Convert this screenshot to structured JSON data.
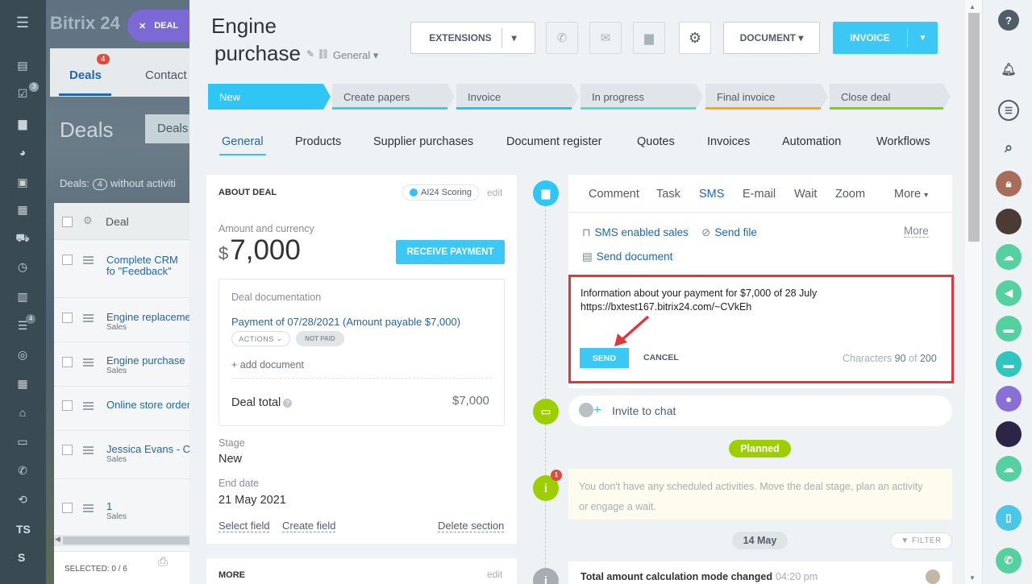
{
  "background": {
    "logo": "Bitrix 24",
    "deal_chip": "DEAL",
    "tabs": [
      {
        "label": "Deals",
        "count": "4"
      },
      {
        "label": "Contact"
      }
    ],
    "title": "Deals",
    "deals_button": "Deals",
    "filter_text": "Deals:",
    "filter_count": "4",
    "filter_suffix": "without activiti",
    "grid_header": "Deal",
    "rows": [
      {
        "title": "Complete CRM fo \"Feedback\"",
        "sub": ""
      },
      {
        "title": "Engine replaceme",
        "sub": "Sales"
      },
      {
        "title": "Engine purchase",
        "sub": "Sales"
      },
      {
        "title": "Online store order",
        "sub": ""
      },
      {
        "title": "Jessica Evans - C",
        "sub": "Sales"
      },
      {
        "title": "1",
        "sub": "Sales"
      }
    ],
    "footer": "SELECTED: 0 / 6",
    "left_icons": [
      "feed-icon",
      "tasks-icon",
      "chat-icon",
      "groups-icon",
      "contacts-icon",
      "calendar-icon",
      "shop-icon",
      "time-icon",
      "documents-icon",
      "crm-icon",
      "target-icon",
      "apps-icon",
      "store-icon",
      "calendar2-icon",
      "phone-icon",
      "sync-icon"
    ],
    "left_badges": {
      "tasks": "3",
      "crm": "4"
    },
    "left_text": [
      "TS",
      "S"
    ]
  },
  "header": {
    "title_line1": "Engine",
    "title_line2": "purchase",
    "category": "General",
    "buttons": {
      "extensions": "EXTENSIONS",
      "document": "DOCUMENT",
      "invoice": "INVOICE"
    }
  },
  "stages": [
    {
      "label": "New",
      "color": "#2fc6f6"
    },
    {
      "label": "Create papers",
      "color": "#3bc8f5"
    },
    {
      "label": "Invoice",
      "color": "#1ec6fa"
    },
    {
      "label": "In progress",
      "color": "#47e4c2"
    },
    {
      "label": "Final invoice",
      "color": "#ffa900"
    },
    {
      "label": "Close deal",
      "color": "#7bd500"
    }
  ],
  "tabs": [
    "General",
    "Products",
    "Supplier purchases",
    "Document register",
    "Quotes",
    "Invoices",
    "Automation",
    "Workflows"
  ],
  "about": {
    "heading": "ABOUT DEAL",
    "ai_scoring": "AI24 Scoring",
    "edit": "edit",
    "amount_label": "Amount and currency",
    "currency": "$",
    "amount": "7,000",
    "receive_payment": "RECEIVE PAYMENT",
    "doc_label": "Deal documentation",
    "doc_link": "Payment of 07/28/2021 (Amount payable $7,000)",
    "actions": "ACTIONS",
    "not_paid": "NOT PAID",
    "add_document": "+ add document",
    "deal_total_label": "Deal total",
    "deal_total_value": "$7,000",
    "stage_label": "Stage",
    "stage_value": "New",
    "end_date_label": "End date",
    "end_date_value": "21 May 2021",
    "select_field": "Select field",
    "create_field": "Create field",
    "delete_section": "Delete section",
    "more_heading": "MORE",
    "more_edit": "edit"
  },
  "editor": {
    "tabs": [
      "Comment",
      "Task",
      "SMS",
      "E-mail",
      "Wait",
      "Zoom",
      "More"
    ],
    "active_tab": "SMS",
    "sms_enabled_sales": "SMS enabled sales",
    "send_file": "Send file",
    "more": "More",
    "send_document": "Send document",
    "message": "Information about your payment for $7,000 of 28 July\nhttps://bxtest167.bitrix24.com/~CVkEh",
    "send": "SEND",
    "cancel": "CANCEL",
    "chars_label": "Characters",
    "chars_count": "90",
    "chars_of": "of",
    "chars_max": "200"
  },
  "timeline": {
    "invite": "Invite to chat",
    "planned": "Planned",
    "badge": "1",
    "empty_text": "You don't have any scheduled activities. Move the deal stage, plan an activity or engage a wait.",
    "date": "14 May",
    "filter": "FILTER",
    "event_title": "Total amount calculation mode changed",
    "event_time": "04:20 pm"
  },
  "rightbar": {
    "icons": [
      "help-icon",
      "bell-icon",
      "chat-search-icon",
      "search-icon",
      "lock-icon",
      "avatar",
      "cloud-icon",
      "megaphone-icon",
      "openline-icon",
      "openline2-icon",
      "user-icon",
      "avatar2",
      "cloud2-icon",
      "mobile-icon",
      "phone-icon"
    ]
  }
}
